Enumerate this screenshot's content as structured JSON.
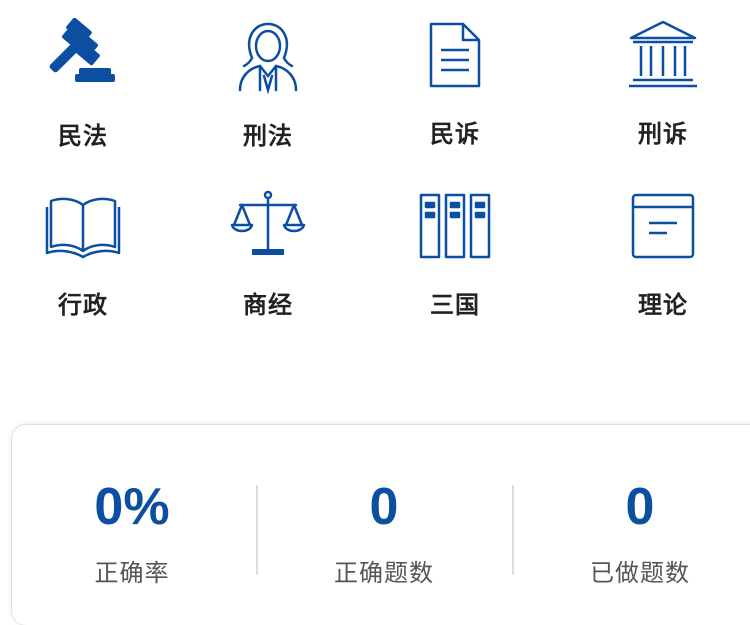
{
  "accent_color": "#0b4ea2",
  "categories": [
    {
      "label": "民法",
      "icon": "gavel-icon"
    },
    {
      "label": "刑法",
      "icon": "judge-icon"
    },
    {
      "label": "民诉",
      "icon": "document-icon"
    },
    {
      "label": "刑诉",
      "icon": "courthouse-icon"
    },
    {
      "label": "行政",
      "icon": "open-book-icon"
    },
    {
      "label": "商经",
      "icon": "scales-icon"
    },
    {
      "label": "三国",
      "icon": "binders-icon"
    },
    {
      "label": "理论",
      "icon": "notebook-icon"
    }
  ],
  "stats": [
    {
      "value": "0%",
      "caption": "正确率"
    },
    {
      "value": "0",
      "caption": "正确题数"
    },
    {
      "value": "0",
      "caption": "已做题数"
    }
  ]
}
